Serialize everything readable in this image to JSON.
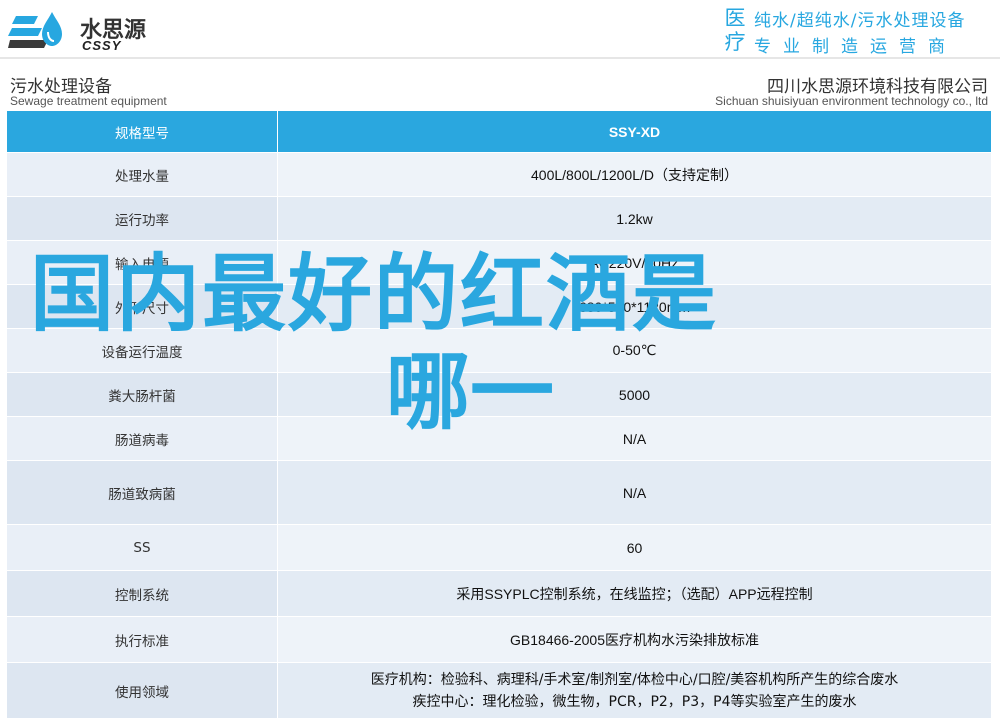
{
  "brand": {
    "name_cn": "水思源",
    "name_en": "CSSY",
    "slogan_char1": "医",
    "slogan_char2": "疗",
    "slogan_line1": "纯水/超纯水/污水处理设备",
    "slogan_line2": "专业制造运营商",
    "colors": {
      "accent": "#2aa7df",
      "dark": "#333333"
    }
  },
  "subheader": {
    "left_cn": "污水处理设备",
    "left_en": "Sewage treatment equipment",
    "right_cn": "四川水思源环境科技有限公司",
    "right_en": "Sichuan shuisiyuan environment technology co., ltd"
  },
  "table": {
    "header": {
      "label": "规格型号",
      "value": "SSY-XD"
    },
    "rows": [
      {
        "label": "处理水量",
        "value": "400L/800L/1200L/D（支持定制）"
      },
      {
        "label": "运行功率",
        "value": "1.2kw"
      },
      {
        "label": "输入电源",
        "value": "AC220V/50HZ"
      },
      {
        "label": "外形尺寸",
        "value": "680*560*1120mm"
      },
      {
        "label": "设备运行温度",
        "value": "0-50℃"
      },
      {
        "label": "粪大肠杆菌",
        "value": "5000"
      },
      {
        "label": "肠道病毒",
        "value": "N/A"
      },
      {
        "label": "肠道致病菌",
        "value": "N/A"
      },
      {
        "label": "SS",
        "value": "60"
      },
      {
        "label": "控制系统",
        "value": "采用SSYPLC控制系统，在线监控；（选配）APP远程控制"
      },
      {
        "label": "执行标准",
        "value": "GB18466-2005医疗机构水污染排放标准"
      },
      {
        "label": "使用领域",
        "value_line1": "医疗机构：检验科、病理科/手术室/制剂室/体检中心/口腔/美容机构所产生的综合废水",
        "value_line2": "疾控中心：理化检验，微生物，PCR，P2，P3，P4等实验室产生的废水"
      }
    ]
  },
  "overlay": {
    "line1": "国内最好的红酒是",
    "line2": "哪一"
  }
}
